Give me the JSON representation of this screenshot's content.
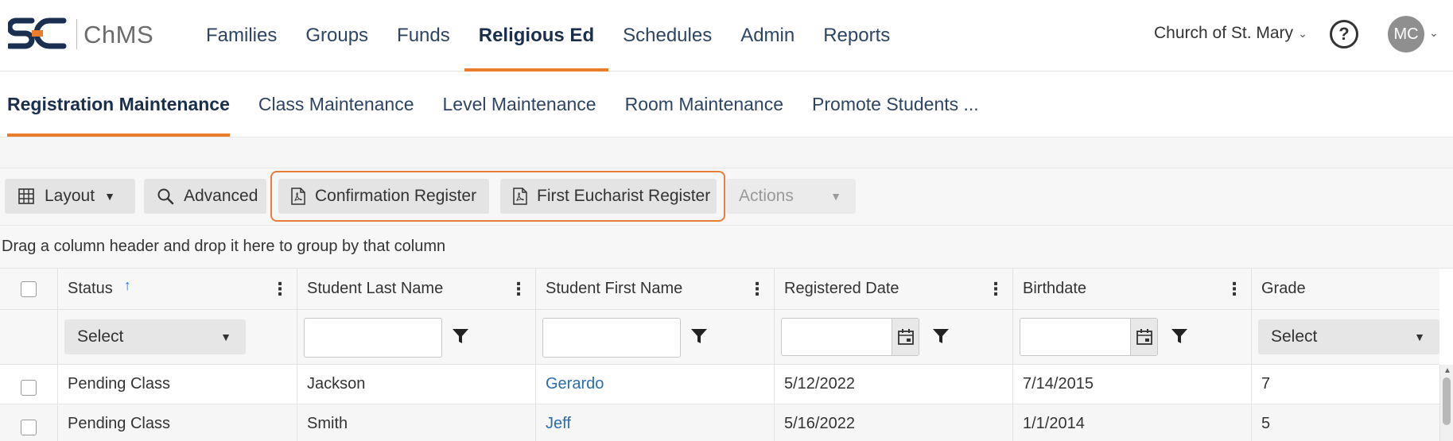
{
  "brand": {
    "logo_text": "SC",
    "app_name": "ChMS",
    "logo_color": "#1b3050",
    "logo_accent": "#ea7d2b"
  },
  "nav": {
    "items": [
      {
        "label": "Families",
        "active": false
      },
      {
        "label": "Groups",
        "active": false
      },
      {
        "label": "Funds",
        "active": false
      },
      {
        "label": "Religious Ed",
        "active": true
      },
      {
        "label": "Schedules",
        "active": false
      },
      {
        "label": "Admin",
        "active": false
      },
      {
        "label": "Reports",
        "active": false
      }
    ],
    "accent_color": "#ea7d2b"
  },
  "header_right": {
    "church": "Church of St. Mary",
    "help_icon": "?",
    "avatar_initials": "MC"
  },
  "subnav": {
    "tabs": [
      {
        "label": "Registration Maintenance",
        "active": true
      },
      {
        "label": "Class Maintenance",
        "active": false
      },
      {
        "label": "Level Maintenance",
        "active": false
      },
      {
        "label": "Room Maintenance",
        "active": false
      },
      {
        "label": "Promote Students ...",
        "active": false
      }
    ]
  },
  "toolbar": {
    "layout_label": "Layout",
    "advanced_label": "Advanced",
    "confirmation_label": "Confirmation Register",
    "eucharist_label": "First Eucharist Register",
    "actions_label": "Actions"
  },
  "groupbar": {
    "text": "Drag a column header and drop it here to group by that column"
  },
  "grid": {
    "columns": [
      "Status",
      "Student Last Name",
      "Student First Name",
      "Registered Date",
      "Birthdate",
      "Grade"
    ],
    "sort": {
      "column": "Status",
      "direction": "ascending"
    },
    "filters": {
      "status_select": "Select",
      "grade_select": "Select"
    },
    "rows": [
      {
        "status": "Pending Class",
        "last": "Jackson",
        "first": "Gerardo",
        "registered": "5/12/2022",
        "birthdate": "7/14/2015",
        "grade": "7"
      },
      {
        "status": "Pending Class",
        "last": "Smith",
        "first": "Jeff",
        "registered": "5/16/2022",
        "birthdate": "1/1/2014",
        "grade": "5"
      }
    ]
  }
}
